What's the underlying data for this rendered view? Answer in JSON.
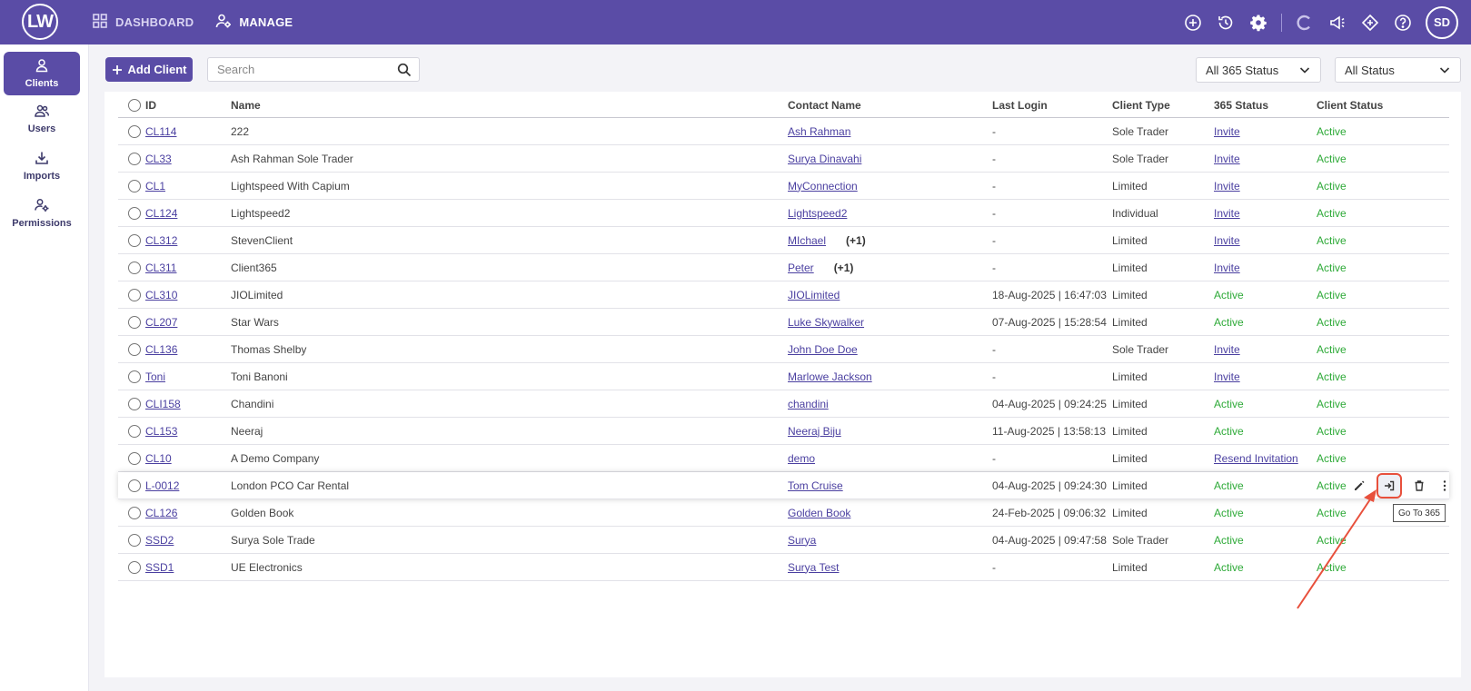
{
  "brand": {
    "logo": "LW"
  },
  "nav": [
    {
      "label": "DASHBOARD",
      "icon": "grid-icon"
    },
    {
      "label": "MANAGE",
      "icon": "manage-icon"
    }
  ],
  "user": {
    "initials": "SD"
  },
  "sidebar": {
    "items": [
      {
        "label": "Clients",
        "icon": "client-icon",
        "active": true
      },
      {
        "label": "Users",
        "icon": "users-icon"
      },
      {
        "label": "Imports",
        "icon": "import-icon"
      },
      {
        "label": "Permissions",
        "icon": "permissions-icon"
      }
    ]
  },
  "toolbar": {
    "add_label": "Add Client",
    "search_placeholder": "Search",
    "filter_365": "All 365 Status",
    "filter_status": "All Status"
  },
  "table": {
    "columns": [
      "ID",
      "Name",
      "Contact Name",
      "Last Login",
      "Client Type",
      "365 Status",
      "Client Status"
    ],
    "rows": [
      {
        "id": "CL114",
        "name": "222",
        "contact": "Ash Rahman",
        "extra": "",
        "last_login": "-",
        "type": "Sole Trader",
        "s365": "Invite",
        "status": "Active"
      },
      {
        "id": "CL33",
        "name": "Ash Rahman Sole Trader",
        "contact": "Surya Dinavahi",
        "extra": "",
        "last_login": "-",
        "type": "Sole Trader",
        "s365": "Invite",
        "status": "Active"
      },
      {
        "id": "CL1",
        "name": "Lightspeed With Capium",
        "contact": "MyConnection",
        "extra": "",
        "last_login": "-",
        "type": "Limited",
        "s365": "Invite",
        "status": "Active"
      },
      {
        "id": "CL124",
        "name": "Lightspeed2",
        "contact": "Lightspeed2",
        "extra": "",
        "last_login": "-",
        "type": "Individual",
        "s365": "Invite",
        "status": "Active"
      },
      {
        "id": "CL312",
        "name": "StevenClient",
        "contact": "MIchael",
        "extra": "(+1)",
        "last_login": "-",
        "type": "Limited",
        "s365": "Invite",
        "status": "Active"
      },
      {
        "id": "CL311",
        "name": "Client365",
        "contact": "Peter",
        "extra": "(+1)",
        "last_login": "-",
        "type": "Limited",
        "s365": "Invite",
        "status": "Active"
      },
      {
        "id": "CL310",
        "name": "JIOLimited",
        "contact": "JIOLimited",
        "extra": "",
        "last_login": "18-Aug-2025 | 16:47:03",
        "type": "Limited",
        "s365": "Active",
        "status": "Active"
      },
      {
        "id": "CL207",
        "name": "Star Wars",
        "contact": "Luke Skywalker",
        "extra": "",
        "last_login": "07-Aug-2025 | 15:28:54",
        "type": "Limited",
        "s365": "Active",
        "status": "Active"
      },
      {
        "id": "CL136",
        "name": "Thomas Shelby",
        "contact": "John Doe Doe",
        "extra": "",
        "last_login": "-",
        "type": "Sole Trader",
        "s365": "Invite",
        "status": "Active"
      },
      {
        "id": "Toni",
        "name": "Toni Banoni",
        "contact": "Marlowe Jackson",
        "extra": "",
        "last_login": "-",
        "type": "Limited",
        "s365": "Invite",
        "status": "Active"
      },
      {
        "id": "CLI158",
        "name": "Chandini",
        "contact": "chandini",
        "extra": "",
        "last_login": "04-Aug-2025 | 09:24:25",
        "type": "Limited",
        "s365": "Active",
        "status": "Active"
      },
      {
        "id": "CL153",
        "name": "Neeraj",
        "contact": "Neeraj Biju",
        "extra": "",
        "last_login": "11-Aug-2025 | 13:58:13",
        "type": "Limited",
        "s365": "Active",
        "status": "Active"
      },
      {
        "id": "CL10",
        "name": "A Demo Company",
        "contact": "demo",
        "extra": "",
        "last_login": "-",
        "type": "Limited",
        "s365": "Resend Invitation",
        "status": "Active"
      },
      {
        "id": "L-0012",
        "name": "London PCO Car Rental",
        "contact": "Tom Cruise",
        "extra": "",
        "last_login": "04-Aug-2025 | 09:24:30",
        "type": "Limited",
        "s365": "Active",
        "status": "Active"
      },
      {
        "id": "CL126",
        "name": "Golden Book",
        "contact": "Golden Book",
        "extra": "",
        "last_login": "24-Feb-2025 | 09:06:32",
        "type": "Limited",
        "s365": "Active",
        "status": "Active"
      },
      {
        "id": "SSD2",
        "name": "Surya Sole Trade",
        "contact": "Surya",
        "extra": "",
        "last_login": "04-Aug-2025 | 09:47:58",
        "type": "Sole Trader",
        "s365": "Active",
        "status": "Active"
      },
      {
        "id": "SSD1",
        "name": "UE Electronics",
        "contact": "Surya Test",
        "extra": "",
        "last_login": "-",
        "type": "Limited",
        "s365": "Active",
        "status": "Active"
      }
    ]
  },
  "row_actions": {
    "icons": [
      "edit-icon",
      "go-to-365-icon",
      "delete-icon",
      "more-icon"
    ],
    "tooltip": "Go To 365"
  },
  "colors": {
    "brand": "#5a4ca6",
    "active": "#2eaa38",
    "link": "#4a3fa0",
    "highlight": "#e8503c"
  }
}
